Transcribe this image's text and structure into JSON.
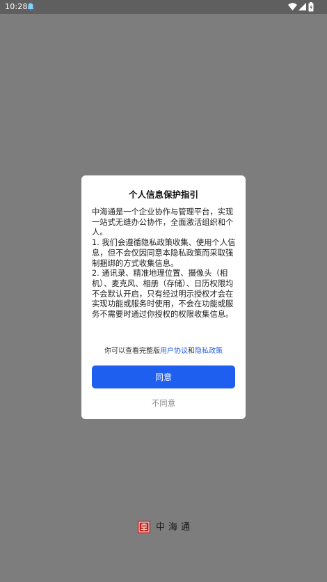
{
  "status_bar": {
    "time": "10:28",
    "icons": [
      "bell-icon",
      "wifi-icon",
      "signal-icon",
      "battery-icon"
    ]
  },
  "dialog": {
    "title": "个人信息保护指引",
    "body": "中海通是一个企业协作与管理平台，实现一站式无缝办公协作，全面激活组织和个人。\n1. 我们会遵循隐私政策收集、使用个人信息，但不会仅因同意本隐私政策而采取强制捆绑的方式收集信息。\n2. 通讯录、精准地理位置、摄像头（相机）、麦克风、相册（存储）、日历权限均不会默认开启，只有经过明示授权才会在实现功能或服务时使用，不会在功能或服务不需要时通过你授权的权限收集信息。",
    "policy_prefix": "你可以查看完整版",
    "user_agreement_link": "用户协议",
    "policy_conjunction": "和",
    "privacy_policy_link": "隐私政策",
    "agree_label": "同意",
    "disagree_label": "不同意"
  },
  "brand": {
    "name": "中海通",
    "logo_icon": "brand-seal-icon"
  },
  "colors": {
    "overlay": "#7d7d7d",
    "status_bar": "#5f5f5f",
    "accent": "#1e5ff0",
    "link": "#2d63e7",
    "logo_red": "#b8221e"
  }
}
